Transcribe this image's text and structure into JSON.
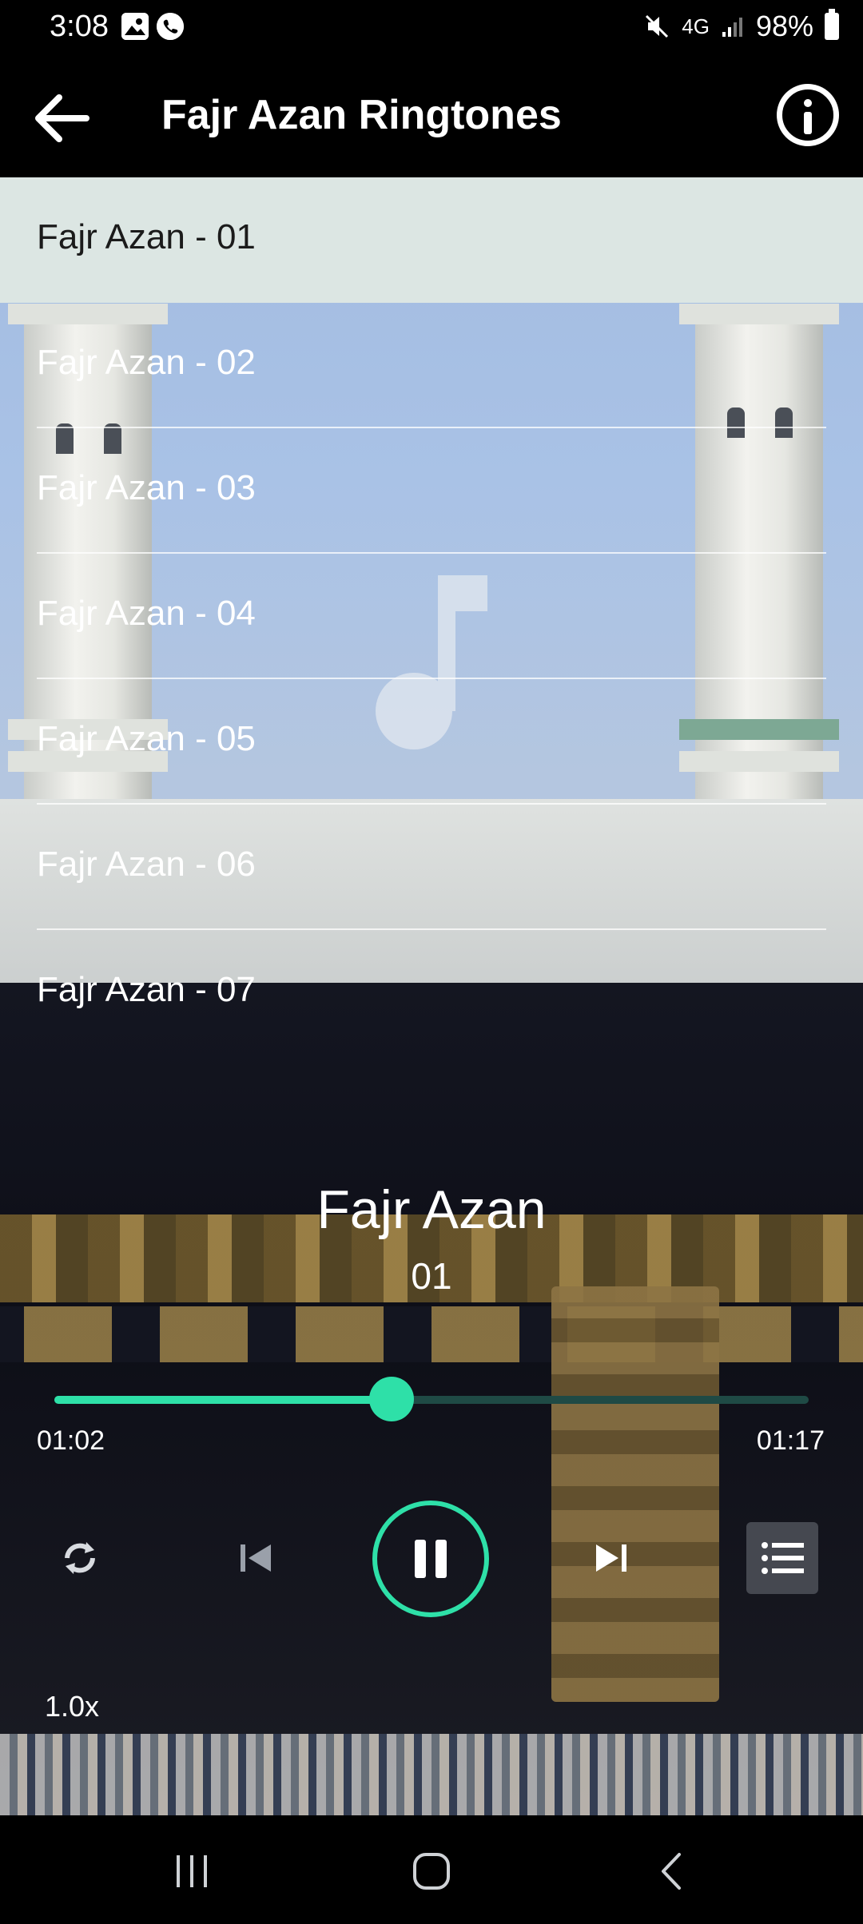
{
  "status_bar": {
    "time": "3:08",
    "battery": "98%",
    "network": "4G",
    "icons": [
      "image-icon",
      "call-icon",
      "mute-icon",
      "signal-icon",
      "battery-icon"
    ]
  },
  "app_bar": {
    "title": "Fajr Azan Ringtones",
    "icons": [
      "back-arrow-icon",
      "info-icon"
    ]
  },
  "tracks": [
    {
      "label": "Fajr Azan - 01",
      "active": true
    },
    {
      "label": "Fajr Azan - 02"
    },
    {
      "label": "Fajr Azan - 03"
    },
    {
      "label": "Fajr Azan - 04"
    },
    {
      "label": "Fajr Azan - 05"
    },
    {
      "label": "Fajr Azan - 06"
    },
    {
      "label": "Fajr Azan - 07"
    }
  ],
  "player": {
    "title": "Fajr Azan",
    "subtitle": "01",
    "current_time": "01:02",
    "duration": "01:17",
    "progress_fraction": 0.447,
    "speed": "1.0x",
    "accent_color": "#2ee0a8",
    "icons": [
      "repeat-icon",
      "previous-icon",
      "pause-icon",
      "next-icon",
      "playlist-icon"
    ]
  },
  "nav_bar": {
    "icons": [
      "recent-apps-icon",
      "home-icon",
      "back-icon"
    ]
  }
}
